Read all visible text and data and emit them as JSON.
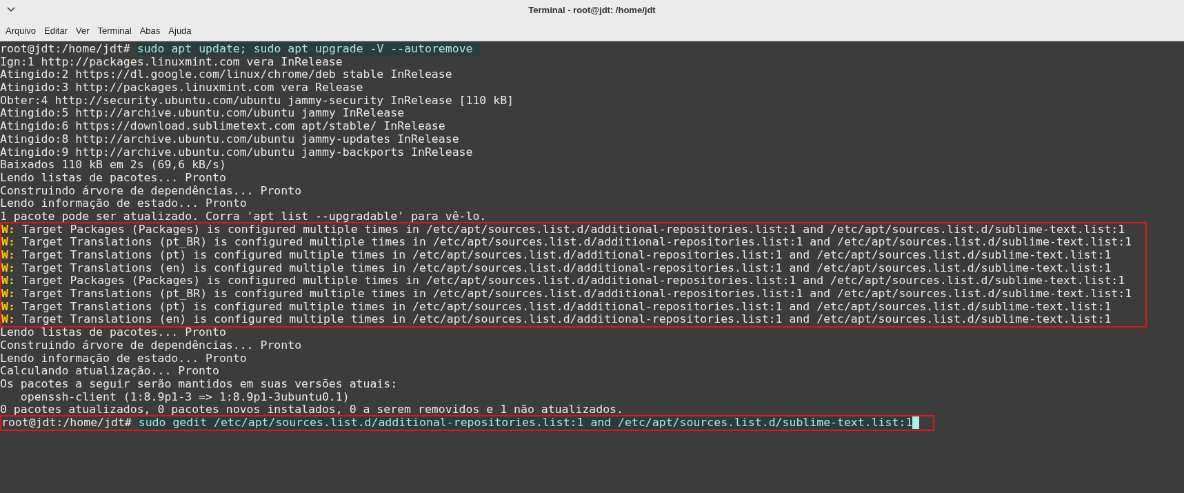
{
  "window": {
    "title": "Terminal - root@jdt: /home/jdt"
  },
  "menu": [
    "Arquivo",
    "Editar",
    "Ver",
    "Terminal",
    "Abas",
    "Ajuda"
  ],
  "blocks": [
    {
      "marked": false,
      "lines": [
        {
          "kind": "prompt",
          "prompt": "root@jdt:/home/jdt#",
          "command": "sudo apt update; sudo apt upgrade -V --autoremove",
          "cursor": false
        },
        {
          "kind": "output",
          "text": "Ign:1 http://packages.linuxmint.com vera InRelease"
        },
        {
          "kind": "output",
          "text": "Atingido:2 https://dl.google.com/linux/chrome/deb stable InRelease"
        },
        {
          "kind": "output",
          "text": "Atingido:3 http://packages.linuxmint.com vera Release"
        },
        {
          "kind": "output",
          "text": "Obter:4 http://security.ubuntu.com/ubuntu jammy-security InRelease [110 kB]"
        },
        {
          "kind": "output",
          "text": "Atingido:5 http://archive.ubuntu.com/ubuntu jammy InRelease"
        },
        {
          "kind": "output",
          "text": "Atingido:6 https://download.sublimetext.com apt/stable/ InRelease"
        },
        {
          "kind": "output",
          "text": "Atingido:8 http://archive.ubuntu.com/ubuntu jammy-updates InRelease"
        },
        {
          "kind": "output",
          "text": "Atingido:9 http://archive.ubuntu.com/ubuntu jammy-backports InRelease"
        },
        {
          "kind": "output",
          "text": "Baixados 110 kB em 2s (69,6 kB/s)"
        },
        {
          "kind": "output",
          "text": "Lendo listas de pacotes... Pronto"
        },
        {
          "kind": "output",
          "text": "Construindo árvore de dependências... Pronto"
        },
        {
          "kind": "output",
          "text": "Lendo informação de estado... Pronto"
        },
        {
          "kind": "output",
          "text": "1 pacote pode ser atualizado. Corra 'apt list --upgradable' para vê-lo."
        }
      ]
    },
    {
      "marked": true,
      "lines": [
        {
          "kind": "warning",
          "tag": "W:",
          "text": "Target Packages (Packages) is configured multiple times in /etc/apt/sources.list.d/additional-repositories.list:1 and /etc/apt/sources.list.d/sublime-text.list:1"
        },
        {
          "kind": "warning",
          "tag": "W:",
          "text": "Target Translations (pt_BR) is configured multiple times in /etc/apt/sources.list.d/additional-repositories.list:1 and /etc/apt/sources.list.d/sublime-text.list:1"
        },
        {
          "kind": "warning",
          "tag": "W:",
          "text": "Target Translations (pt) is configured multiple times in /etc/apt/sources.list.d/additional-repositories.list:1 and /etc/apt/sources.list.d/sublime-text.list:1"
        },
        {
          "kind": "warning",
          "tag": "W:",
          "text": "Target Translations (en) is configured multiple times in /etc/apt/sources.list.d/additional-repositories.list:1 and /etc/apt/sources.list.d/sublime-text.list:1"
        },
        {
          "kind": "warning",
          "tag": "W:",
          "text": "Target Packages (Packages) is configured multiple times in /etc/apt/sources.list.d/additional-repositories.list:1 and /etc/apt/sources.list.d/sublime-text.list:1"
        },
        {
          "kind": "warning",
          "tag": "W:",
          "text": "Target Translations (pt_BR) is configured multiple times in /etc/apt/sources.list.d/additional-repositories.list:1 and /etc/apt/sources.list.d/sublime-text.list:1"
        },
        {
          "kind": "warning",
          "tag": "W:",
          "text": "Target Translations (pt) is configured multiple times in /etc/apt/sources.list.d/additional-repositories.list:1 and /etc/apt/sources.list.d/sublime-text.list:1"
        },
        {
          "kind": "warning",
          "tag": "W:",
          "text": "Target Translations (en) is configured multiple times in /etc/apt/sources.list.d/additional-repositories.list:1 and /etc/apt/sources.list.d/sublime-text.list:1"
        }
      ]
    },
    {
      "marked": false,
      "lines": [
        {
          "kind": "output",
          "text": "Lendo listas de pacotes... Pronto"
        },
        {
          "kind": "output",
          "text": "Construindo árvore de dependências... Pronto"
        },
        {
          "kind": "output",
          "text": "Lendo informação de estado... Pronto"
        },
        {
          "kind": "output",
          "text": "Calculando atualização... Pronto"
        },
        {
          "kind": "output",
          "text": "Os pacotes a seguir serão mantidos em suas versões atuais:"
        },
        {
          "kind": "output",
          "text": "   openssh-client (1:8.9p1-3 => 1:8.9p1-3ubuntu0.1)"
        },
        {
          "kind": "output",
          "text": "0 pacotes atualizados, 0 pacotes novos instalados, 0 a serem removidos e 1 não atualizados."
        }
      ]
    },
    {
      "marked": true,
      "lines": [
        {
          "kind": "prompt",
          "prompt": "root@jdt:/home/jdt#",
          "command": "sudo gedit /etc/apt/sources.list.d/additional-repositories.list:1 and /etc/apt/sources.list.d/sublime-text.list:1",
          "cursor": true
        }
      ]
    }
  ]
}
